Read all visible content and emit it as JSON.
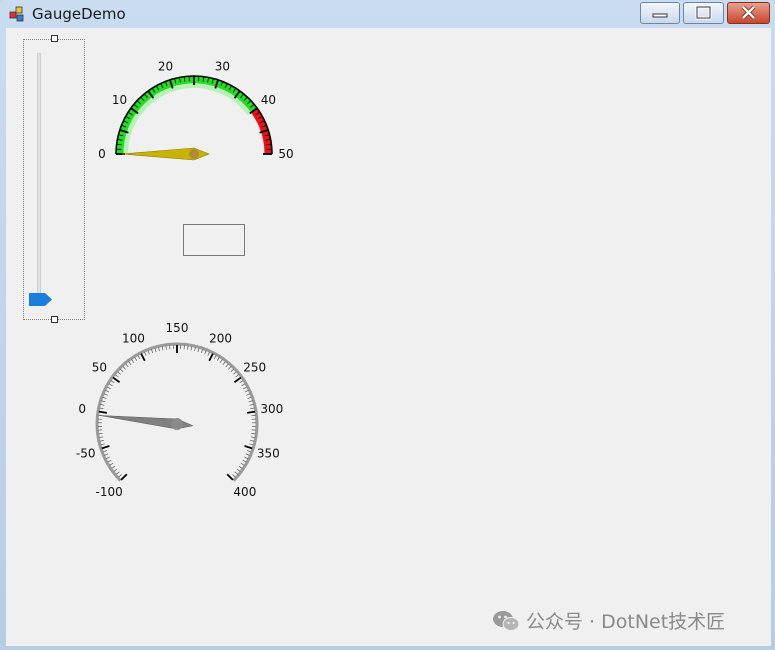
{
  "window": {
    "title": "GaugeDemo"
  },
  "titlebar_icons": [
    "app-icon",
    "minimize-icon",
    "maximize-icon",
    "close-icon"
  ],
  "trackbar": {
    "value_fraction": 0.0
  },
  "speed_gauge": {
    "min": 0,
    "max": 50,
    "tick_labels": [
      "0",
      "10",
      "20",
      "30",
      "40",
      "50"
    ],
    "ranges": [
      {
        "from": 0,
        "to": 40,
        "color": "#22dd22"
      },
      {
        "from": 40,
        "to": 50,
        "color": "#ee1111"
      }
    ],
    "needle_value": 0,
    "needle_color": "#c8b400"
  },
  "readout_box": {
    "text": ""
  },
  "dial_gauge": {
    "min": -100,
    "max": 400,
    "tick_labels": [
      "-100",
      "-50",
      "0",
      "50",
      "100",
      "150",
      "200",
      "250",
      "300",
      "350",
      "400"
    ],
    "needle_value": -5,
    "needle_color": "#808080"
  },
  "watermark": {
    "text": "公众号 · DotNet技术匠",
    "icon": "wechat-icon"
  }
}
